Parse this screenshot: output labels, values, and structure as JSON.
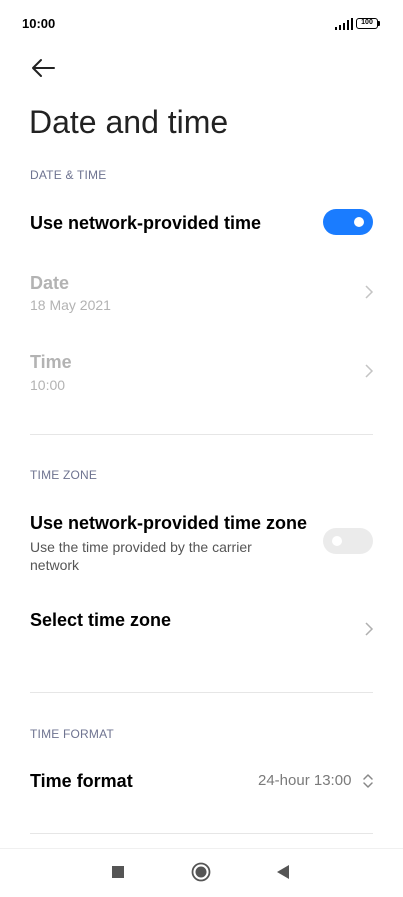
{
  "status_bar": {
    "time": "10:00",
    "battery": "100"
  },
  "header": {
    "title": "Date and time",
    "back_icon": "arrow-left-icon"
  },
  "date_time_section": {
    "label": "DATE & TIME",
    "network_time": {
      "title": "Use network-provided time",
      "enabled": true
    },
    "date": {
      "title": "Date",
      "value": "18 May 2021"
    },
    "time": {
      "title": "Time",
      "value": "10:00"
    }
  },
  "time_zone_section": {
    "label": "TIME ZONE",
    "network_zone": {
      "title": "Use network-provided time zone",
      "description": "Use the time provided by the carrier network",
      "enabled": false
    },
    "select_zone": {
      "title": "Select time zone"
    }
  },
  "time_format_section": {
    "label": "TIME FORMAT",
    "format": {
      "title": "Time format",
      "value": "24-hour 13:00"
    }
  },
  "colors": {
    "accent": "#1a7cff",
    "section_label": "#6e7390",
    "disabled_text": "#b3b3b3"
  },
  "nav_bar": {
    "icons": [
      "recents-square-icon",
      "home-circle-icon",
      "back-triangle-icon"
    ]
  }
}
